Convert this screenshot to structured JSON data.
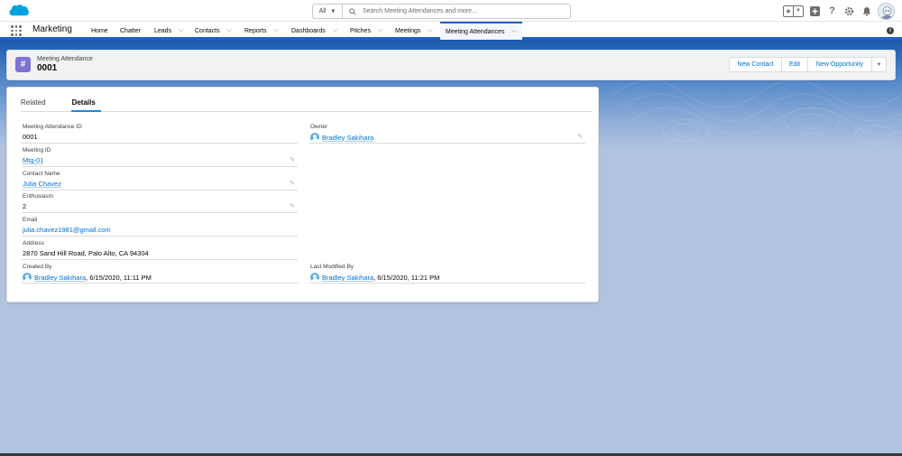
{
  "header": {
    "search": {
      "scope": "All",
      "placeholder": "Search Meeting Attendances and more..."
    },
    "icons": [
      "favorites-star-icon",
      "add-icon",
      "help-icon",
      "setup-gear-icon",
      "notification-bell-icon",
      "user-avatar"
    ]
  },
  "nav": {
    "app_name": "Marketing",
    "items": [
      {
        "label": "Home",
        "menu": false
      },
      {
        "label": "Chatter",
        "menu": false
      },
      {
        "label": "Leads",
        "menu": true
      },
      {
        "label": "Contacts",
        "menu": true
      },
      {
        "label": "Reports",
        "menu": true
      },
      {
        "label": "Dashboards",
        "menu": true
      },
      {
        "label": "Pitches",
        "menu": true
      },
      {
        "label": "Meetings",
        "menu": true
      },
      {
        "label": "Meeting Attendances",
        "menu": true,
        "active": true
      }
    ]
  },
  "record": {
    "object_type": "Meeting Attendance",
    "name": "0001",
    "actions": [
      "New Contact",
      "Edit",
      "New Opportunity"
    ]
  },
  "tabs": [
    {
      "label": "Related",
      "active": false
    },
    {
      "label": "Details",
      "active": true
    }
  ],
  "fields": {
    "attendance_id": {
      "label": "Meeting Attendance ID",
      "value": "0001"
    },
    "meeting_id": {
      "label": "Meeting ID",
      "value": "Mtg-01"
    },
    "contact_name": {
      "label": "Contact Name",
      "value": "Julia Chavez"
    },
    "enthusiasm": {
      "label": "Enthusiasm",
      "value": "2"
    },
    "email": {
      "label": "Email",
      "value": "julia.chavez1981@gmail.com"
    },
    "address": {
      "label": "Address",
      "value": "2870 Sand Hill Road, Palo Alto, CA 94304"
    },
    "created_by": {
      "label": "Created By",
      "user": "Bradley Sakihara",
      "date": ", 6/15/2020, 11:11 PM"
    },
    "owner": {
      "label": "Owner",
      "user": "Bradley Sakihara"
    },
    "last_modified_by": {
      "label": "Last Modified By",
      "user": "Bradley Sakihara",
      "date": ", 6/15/2020, 11:21 PM"
    }
  },
  "colors": {
    "brand": "#1f61bd",
    "link": "#0070d2",
    "object_icon": "#7e72d5",
    "background": "#b0c4df"
  }
}
